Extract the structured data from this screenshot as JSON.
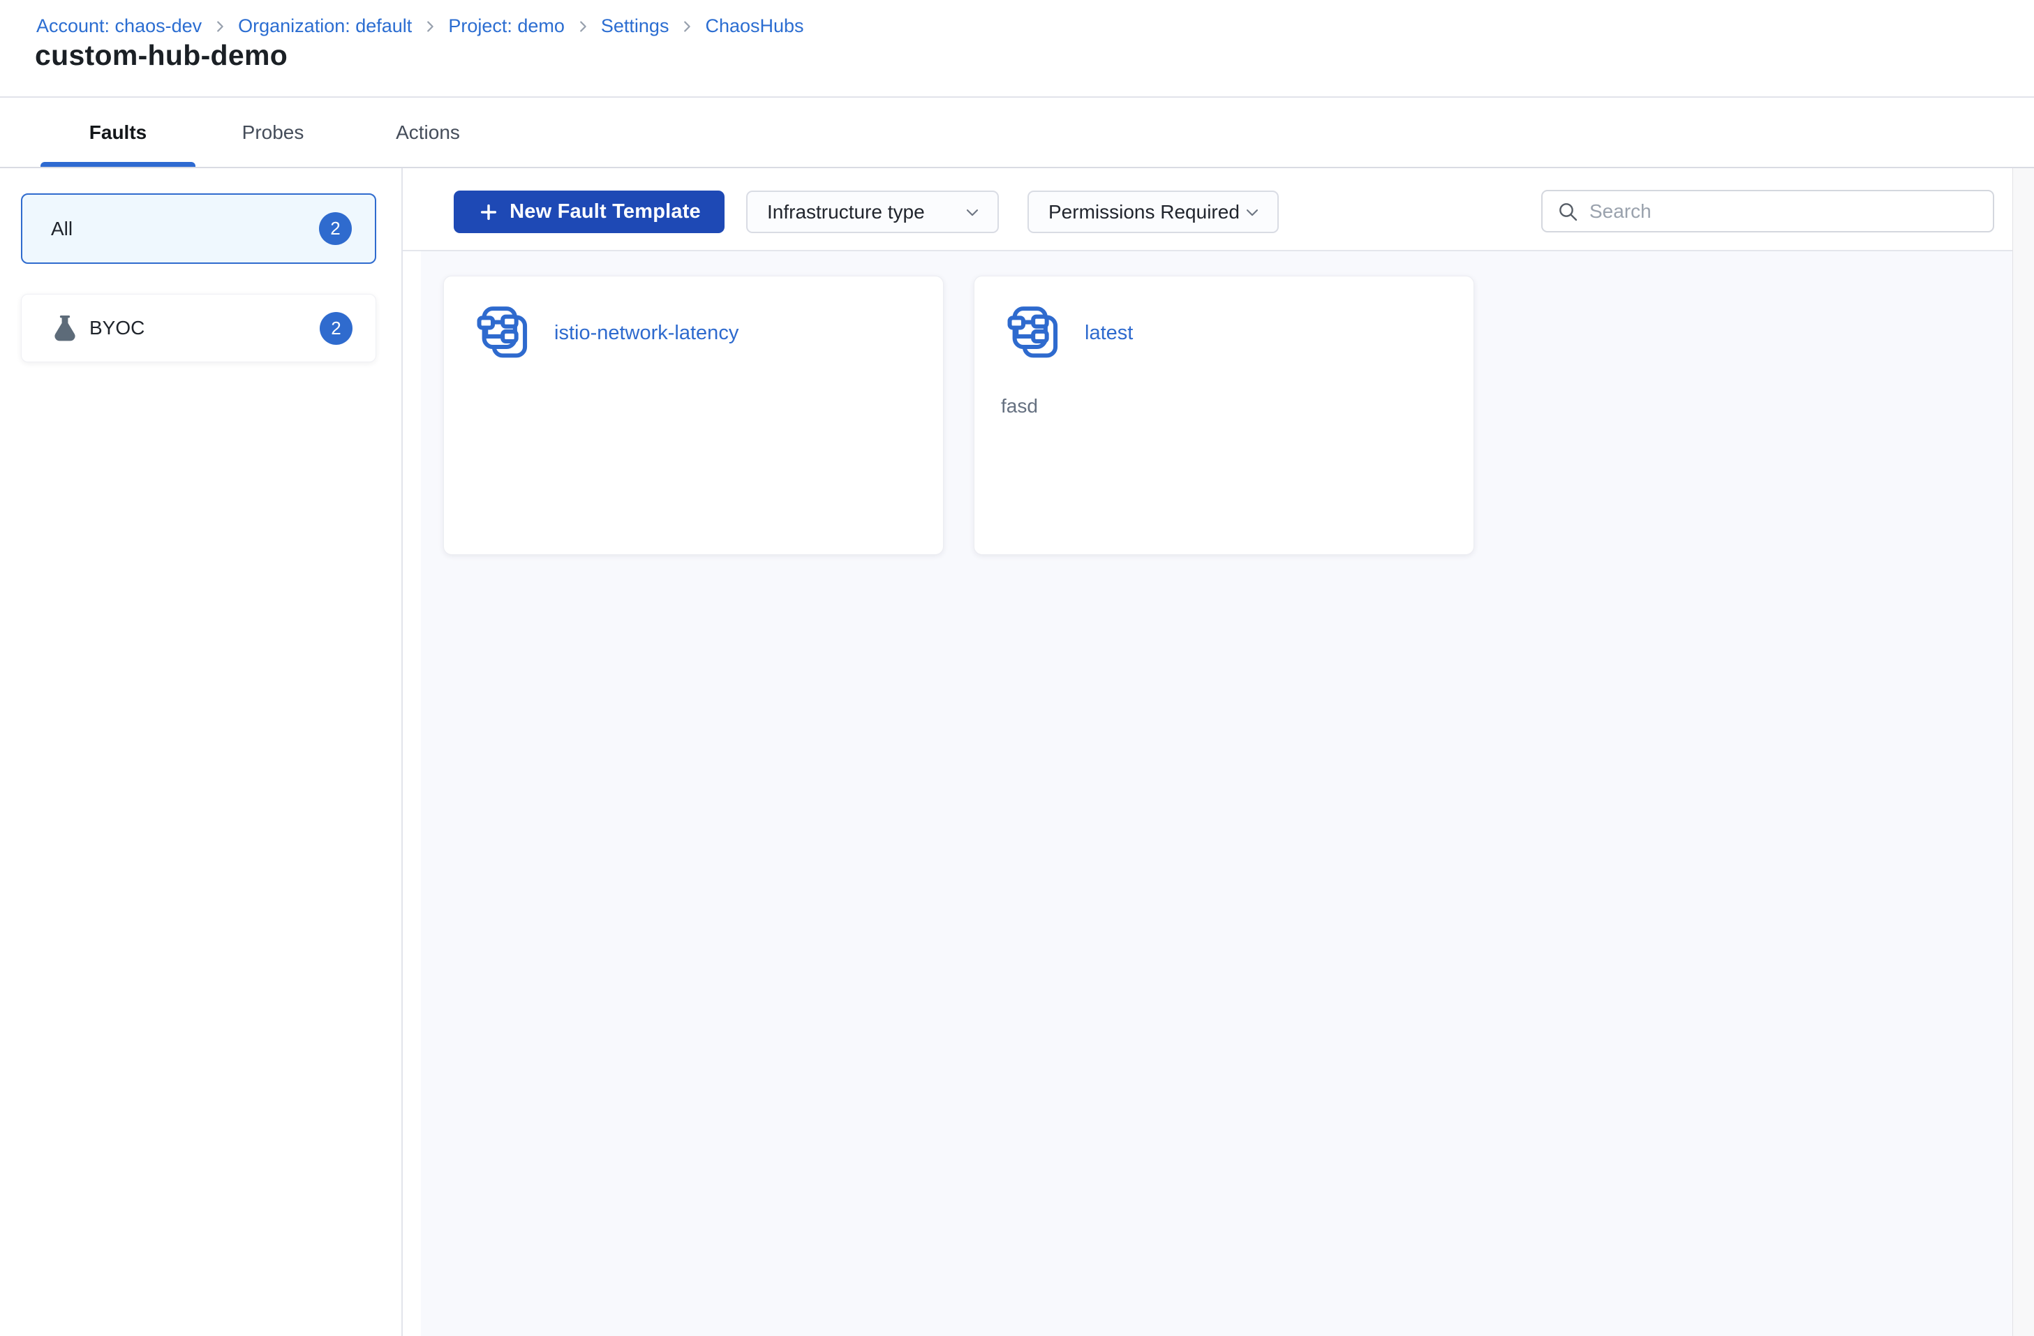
{
  "breadcrumb": {
    "items": [
      {
        "label": "Account: chaos-dev"
      },
      {
        "label": "Organization: default"
      },
      {
        "label": "Project: demo"
      },
      {
        "label": "Settings"
      },
      {
        "label": "ChaosHubs"
      }
    ],
    "separator": "›"
  },
  "page": {
    "title": "custom-hub-demo"
  },
  "tabs": [
    {
      "label": "Faults",
      "active": true
    },
    {
      "label": "Probes",
      "active": false
    },
    {
      "label": "Actions",
      "active": false
    }
  ],
  "sidebar": {
    "filters": [
      {
        "label": "All",
        "count": "2",
        "selected": true
      },
      {
        "label": "BYOC",
        "count": "2",
        "icon": "flask-icon",
        "selected": false
      }
    ]
  },
  "toolbar": {
    "new_template_label": "New Fault Template",
    "filters": [
      {
        "label": "Infrastructure type"
      },
      {
        "label": "Permissions Required"
      }
    ],
    "search": {
      "placeholder": "Search",
      "value": ""
    }
  },
  "cards": [
    {
      "title": "istio-network-latency",
      "description": ""
    },
    {
      "title": "latest",
      "description": "fasd"
    }
  ],
  "icons": {
    "plus": "+",
    "search": "magnifier",
    "chevron_down": "∨",
    "breadcrumb_separator": "›",
    "flask": "lab-flask",
    "fault_template": "stacked-flowchart-pages"
  },
  "colors": {
    "link_blue": "#2b6dd1",
    "accent_blue": "#2f6bce",
    "active_tab_underline": "#2e6ad1",
    "primary_button": "#1e49b5",
    "selected_filter_bg": "#eff8fe",
    "badge_bg": "#2f6bce",
    "main_panel_bg": "#f8f9fd",
    "card_title": "#2e6ace",
    "description_text": "#657080"
  }
}
